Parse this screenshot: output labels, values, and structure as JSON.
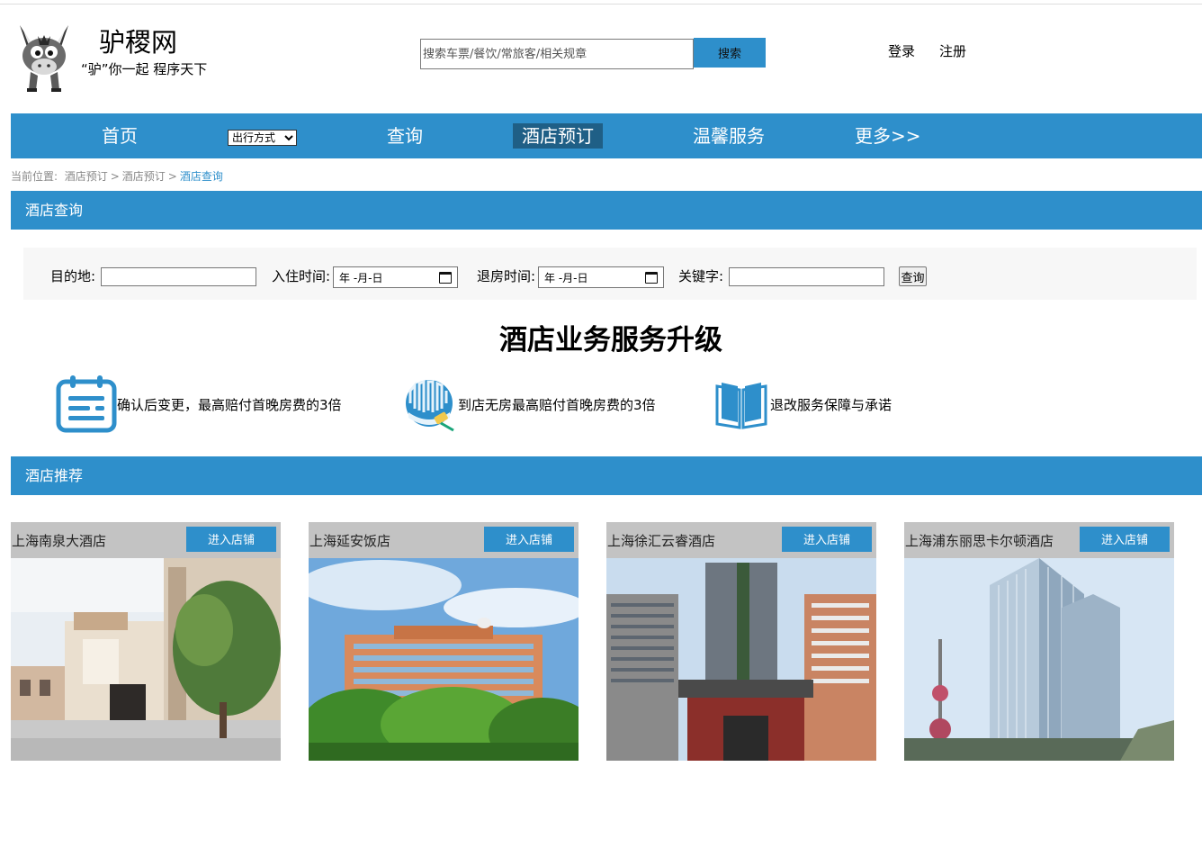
{
  "header": {
    "site_name": "驴稷网",
    "slogan": "“驴”你一起 程序天下",
    "search_placeholder": "搜索车票/餐饮/常旅客/相关规章",
    "search_button": "搜索",
    "login": "登录",
    "register": "注册",
    "logo_icon": "donkey-logo"
  },
  "nav": {
    "items": [
      "首页",
      "查询",
      "酒店预订",
      "温馨服务",
      "更多>>"
    ],
    "active": "酒店预订",
    "select_value": "出行方式"
  },
  "breadcrumb": {
    "prefix": "当前位置:",
    "items": [
      "酒店预订",
      "酒店预订",
      "酒店查询"
    ],
    "separator": ">"
  },
  "hotel_search": {
    "section_title": "酒店查询",
    "destination_label": "目的地:",
    "checkin_label": "入住时间:",
    "checkout_label": "退房时间:",
    "keyword_label": "关键字:",
    "date_placeholder": "年 -月-日",
    "query_button": "查询"
  },
  "upgrade": {
    "title": "酒店业务服务升级",
    "items": [
      {
        "icon": "calendar-icon",
        "text": "确认后变更，最高赔付首晚房费的3倍"
      },
      {
        "icon": "building-badge-icon",
        "text": "到店无房最高赔付首晚房费的3倍"
      },
      {
        "icon": "open-book-icon",
        "text": "退改服务保障与承诺"
      }
    ]
  },
  "recommend": {
    "section_title": "酒店推荐",
    "enter_label": "进入店铺",
    "hotels": [
      {
        "name": "上海南泉大酒店"
      },
      {
        "name": "上海延安饭店"
      },
      {
        "name": "上海徐汇云睿酒店"
      },
      {
        "name": "上海浦东丽思卡尔顿酒店"
      }
    ]
  },
  "colors": {
    "primary": "#2e8fcb",
    "nav_active": "#1f5f86",
    "card_header": "#c3c3c3",
    "panel_bg": "#f7f7f7"
  }
}
